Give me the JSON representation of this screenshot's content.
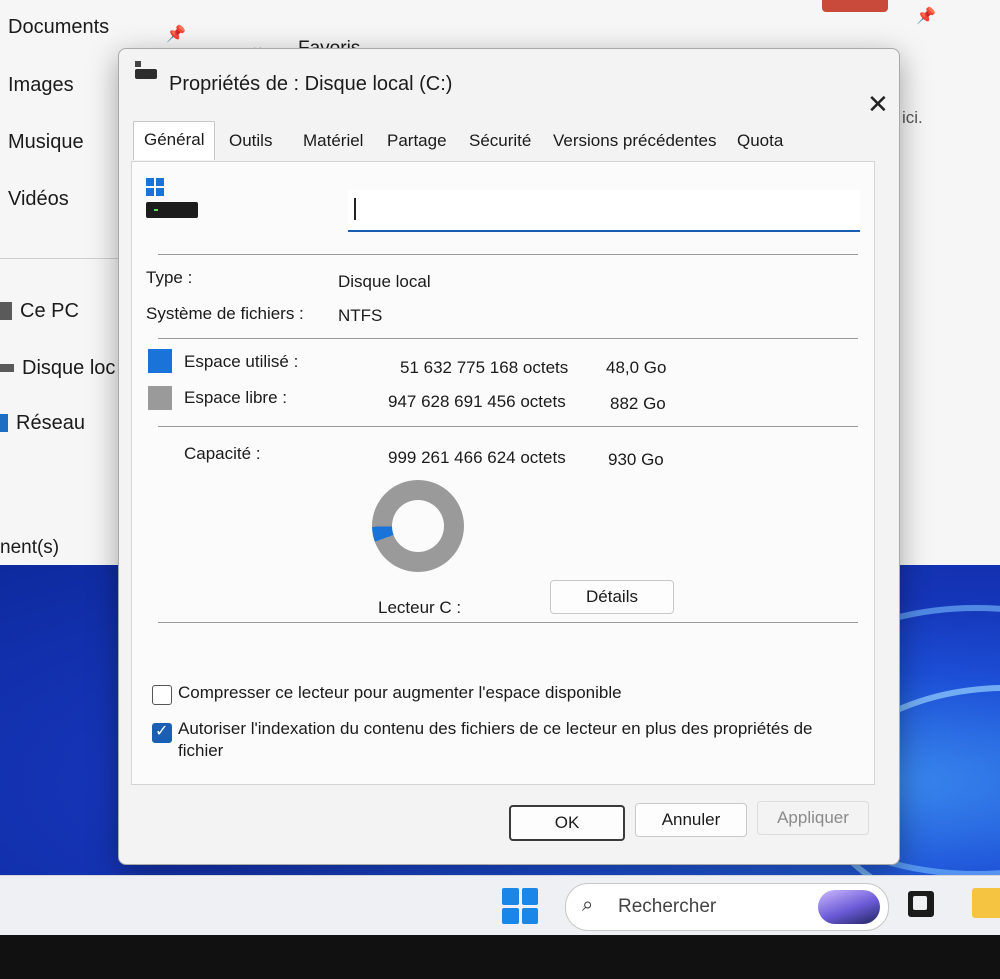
{
  "explorer": {
    "nav_items": [
      {
        "label": "Documents"
      },
      {
        "label": "Images"
      },
      {
        "label": "Musique"
      },
      {
        "label": "Vidéos"
      },
      {
        "label": "Ce PC"
      },
      {
        "label": "Disque loc"
      },
      {
        "label": "Réseau"
      }
    ],
    "favoris_label": "Favoris",
    "chevron": "⌄",
    "pin_glyph": "📌",
    "ici_text": "ici.",
    "status_text": "nent(s)"
  },
  "dialog": {
    "title": "Propriétés de : Disque local (C:)",
    "close_glyph": "✕",
    "tabs": [
      {
        "label": "Général"
      },
      {
        "label": "Outils"
      },
      {
        "label": "Matériel"
      },
      {
        "label": "Partage"
      },
      {
        "label": "Sécurité"
      },
      {
        "label": "Versions précédentes"
      },
      {
        "label": "Quota"
      }
    ],
    "active_tab": "Général",
    "name_field_value": "",
    "type_label": "Type :",
    "type_value": "Disque local",
    "fs_label": "Système de fichiers :",
    "fs_value": "NTFS",
    "used": {
      "label": "Espace utilisé :",
      "bytes": "51 632 775 168 octets",
      "size": "48,0 Go",
      "color": "#1a73d8"
    },
    "free": {
      "label": "Espace libre :",
      "bytes": "947 628 691 456 octets",
      "size": "882 Go",
      "color": "#9a9a9a"
    },
    "capacity": {
      "label": "Capacité :",
      "bytes": "999 261 466 624 octets",
      "size": "930 Go"
    },
    "used_fraction": 0.052,
    "drive_label": "Lecteur C :",
    "details_button": "Détails",
    "compress_label": "Compresser ce lecteur pour augmenter l'espace disponible",
    "compress_checked": false,
    "index_label_line1": "Autoriser l'indexation du contenu des fichiers de ce lecteur en plus des propriétés de",
    "index_label_line2": "fichier",
    "index_checked": true,
    "ok_button": "OK",
    "cancel_button": "Annuler",
    "apply_button": "Appliquer"
  },
  "taskbar": {
    "search_glyph": "⌕",
    "search_placeholder": "Rechercher"
  }
}
